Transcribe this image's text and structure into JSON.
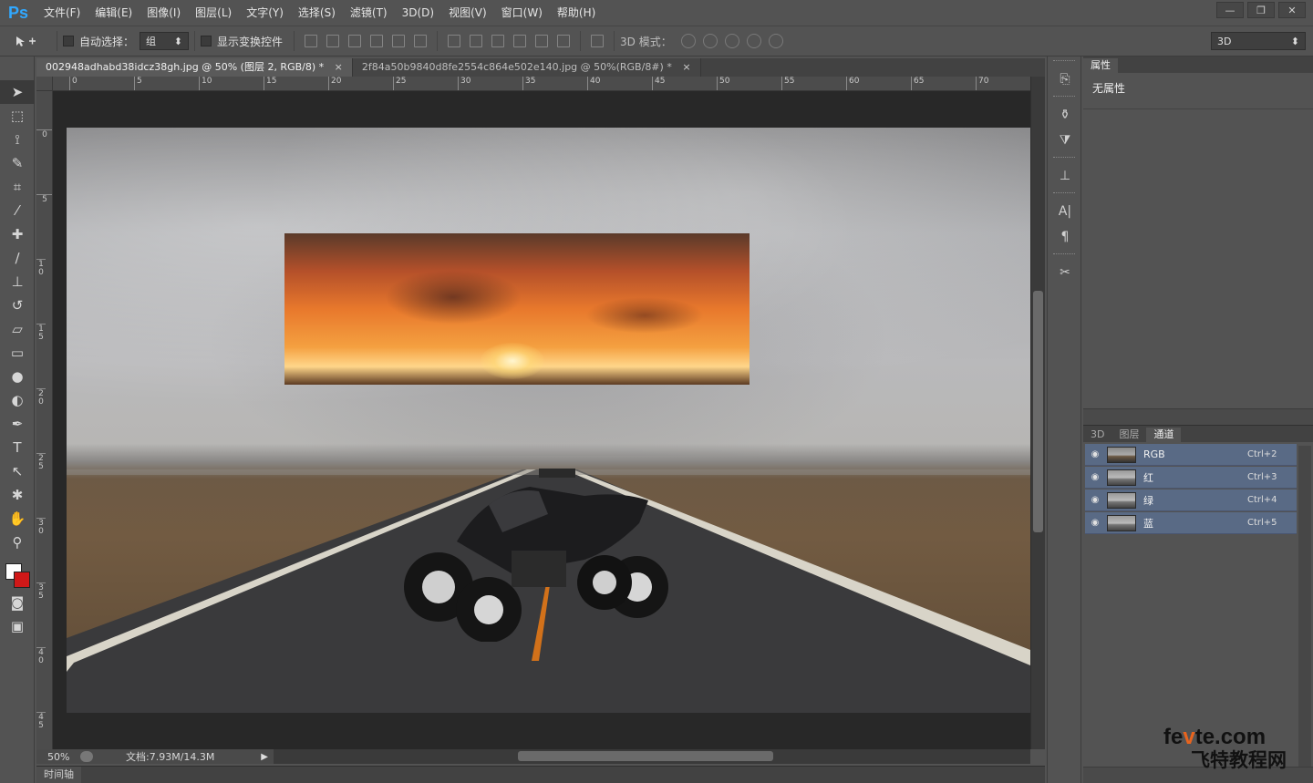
{
  "app": {
    "logo": "Ps"
  },
  "menu": [
    "文件(F)",
    "编辑(E)",
    "图像(I)",
    "图层(L)",
    "文字(Y)",
    "选择(S)",
    "滤镜(T)",
    "3D(D)",
    "视图(V)",
    "窗口(W)",
    "帮助(H)"
  ],
  "window_buttons": {
    "minimize": "—",
    "restore": "❐",
    "close": "✕"
  },
  "options": {
    "auto_select_label": "自动选择：",
    "auto_select_value": "组",
    "show_transform_label": "显示变换控件",
    "mode_3d_label": "3D 模式：",
    "workspace_value": "3D"
  },
  "tabs": [
    {
      "title": "002948adhabd38idcz38gh.jpg @ 50% (图层 2, RGB/8) *",
      "close": "×"
    },
    {
      "title": "2f84a50b9840d8fe2554c864e502e140.jpg @ 50%(RGB/8#) *",
      "close": "×"
    }
  ],
  "ruler": {
    "h": [
      "0",
      "5",
      "10",
      "15",
      "20",
      "25",
      "30",
      "35",
      "40",
      "45",
      "50",
      "55",
      "60",
      "65",
      "70"
    ],
    "v": [
      "0",
      "5",
      "1 0",
      "1 5",
      "2 0",
      "2 5",
      "3 0",
      "3 5",
      "4 0",
      "4 5"
    ]
  },
  "status": {
    "zoom": "50%",
    "doc_info": "文档:7.93M/14.3M"
  },
  "timeline": "时间轴",
  "properties": {
    "tab": "属性",
    "body": "无属性"
  },
  "layer_panel": {
    "tabs": [
      "3D",
      "图层",
      "通道"
    ],
    "active_tab": 2,
    "channels": [
      {
        "name": "RGB",
        "shortcut": "Ctrl+2"
      },
      {
        "name": "红",
        "shortcut": "Ctrl+3"
      },
      {
        "name": "绿",
        "shortcut": "Ctrl+4"
      },
      {
        "name": "蓝",
        "shortcut": "Ctrl+5"
      }
    ]
  },
  "watermark": {
    "line1_a": "fe",
    "line1_v": "v",
    "line1_b": "te.com",
    "line2": "飞特教程网"
  },
  "colors": {
    "foreground": "#ffffff",
    "background": "#d01818",
    "accent": "#31a8ff"
  }
}
